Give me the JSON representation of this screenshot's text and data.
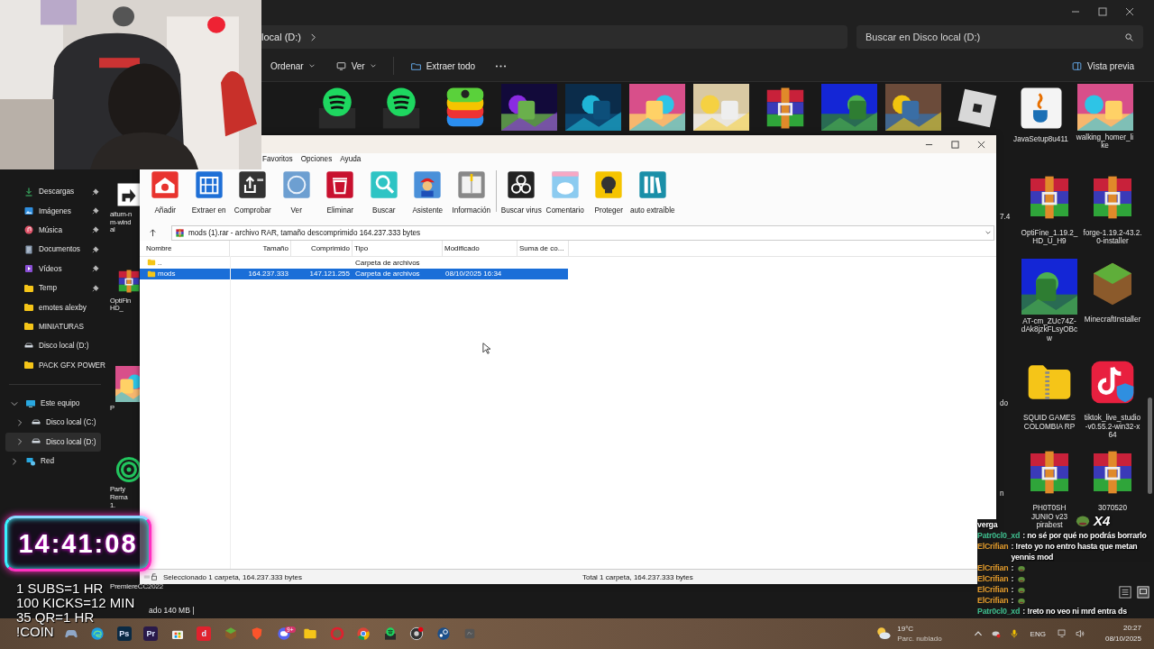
{
  "explorer": {
    "breadcrumb": "local (D:)",
    "search": {
      "placeholder": "Buscar en Disco local (D:)"
    },
    "commands": [
      {
        "label": "Ordenar",
        "kind": "sort",
        "dropdown": true
      },
      {
        "label": "Ver",
        "kind": "view",
        "dropdown": true
      },
      {
        "label": "Extraer todo",
        "kind": "extract",
        "dropdown": false
      }
    ],
    "preview": "Vista previa",
    "quick_access": [
      {
        "label": "Descargas",
        "kind": "download",
        "pinned": true
      },
      {
        "label": "Imágenes",
        "kind": "pictures",
        "pinned": true
      },
      {
        "label": "Música",
        "kind": "music",
        "pinned": true
      },
      {
        "label": "Documentos",
        "kind": "documents",
        "pinned": true
      },
      {
        "label": "Vídeos",
        "kind": "videos",
        "pinned": true
      },
      {
        "label": "Temp",
        "kind": "folder",
        "pinned": true
      },
      {
        "label": "emotes alexby",
        "kind": "folder",
        "pinned": false
      },
      {
        "label": "MINIATURAS",
        "kind": "folder",
        "pinned": false
      },
      {
        "label": "Disco local (D:)",
        "kind": "drive",
        "pinned": false
      },
      {
        "label": "PACK GFX POWER",
        "kind": "folder",
        "pinned": false
      }
    ],
    "tree": [
      {
        "label": "Este equipo",
        "kind": "computer",
        "expanded": true,
        "selected": false,
        "children": [
          {
            "label": "Disco local (C:)",
            "kind": "drive",
            "expanded": false,
            "selected": false
          },
          {
            "label": "Disco local (D:)",
            "kind": "drive",
            "expanded": false,
            "selected": true
          }
        ]
      },
      {
        "label": "Red",
        "kind": "network",
        "expanded": false,
        "selected": false
      }
    ],
    "top_row": [
      {
        "kind": "spotify"
      },
      {
        "kind": "spotify"
      },
      {
        "kind": "bluestacks"
      },
      {
        "kind": "picture"
      },
      {
        "kind": "picture"
      },
      {
        "kind": "picture"
      },
      {
        "kind": "picture"
      },
      {
        "kind": "winrar"
      },
      {
        "kind": "picture"
      },
      {
        "kind": "picture"
      },
      {
        "kind": "roblox"
      },
      {
        "kind": "java",
        "lines": [
          "JavaSetup8u411"
        ]
      },
      {
        "kind": "picture",
        "lines": [
          "walking_homer_li",
          "ke"
        ]
      }
    ],
    "rows": [
      {
        "left": {
          "kind": "shortcut",
          "lines": [
            "aitum-n",
            "m-wind",
            "al"
          ]
        },
        "fragment": "7.4",
        "items": [
          {
            "kind": "winrar",
            "lines": [
              "OptiFine_1.19.2_",
              "HD_U_H9"
            ]
          },
          {
            "kind": "winrar",
            "lines": [
              "forge-1.19.2-43.2.",
              "0-installer"
            ]
          }
        ]
      },
      {
        "left": {
          "kind": "winrar",
          "lines": [
            "OptiFin",
            "HD_"
          ]
        },
        "items": [
          {
            "kind": "picture",
            "lines": [
              "AT-cm_ZUc74Z-",
              "dAk8jzkFLsyOBc",
              "w"
            ]
          },
          {
            "kind": "minecraft",
            "lines": [
              "MinecraftInstaller"
            ]
          }
        ]
      },
      {
        "left": {
          "kind": "picture",
          "lines": [
            "P"
          ]
        },
        "fragment": "do",
        "items": [
          {
            "kind": "zipfolder",
            "lines": [
              "SQUID GAMES",
              "COLOMBIA RP"
            ]
          },
          {
            "kind": "tiktok",
            "lines": [
              "tiktok_live_studio",
              "-v0.55.2-win32-x",
              "64"
            ]
          }
        ]
      },
      {
        "left": {
          "kind": "target",
          "lines": [
            "Party",
            "Rema",
            "1."
          ]
        },
        "fragment": "n",
        "items": [
          {
            "kind": "winrar",
            "lines": [
              "PH0T0SH",
              "JUNIO v23",
              "pirabest"
            ]
          },
          {
            "kind": "winrar",
            "lines": [
              "3070520"
            ]
          }
        ]
      },
      {
        "left": {
          "lines": [
            "PremiereCC2022"
          ]
        }
      }
    ],
    "status_parts": [
      "ado  140 MB  |"
    ]
  },
  "winrar": {
    "menu": [
      "Favoritos",
      "Opciones",
      "Ayuda"
    ],
    "toolbar": [
      {
        "label": "Añadir",
        "kind": "add"
      },
      {
        "label": "Extraer en",
        "kind": "extract"
      },
      {
        "label": "Comprobar",
        "kind": "test"
      },
      {
        "label": "Ver",
        "kind": "view"
      },
      {
        "label": "Eliminar",
        "kind": "delete"
      },
      {
        "label": "Buscar",
        "kind": "find"
      },
      {
        "label": "Asistente",
        "kind": "wizard"
      },
      {
        "label": "Información",
        "kind": "info"
      },
      {
        "label": "Buscar virus",
        "kind": "virus"
      },
      {
        "label": "Comentario",
        "kind": "comment"
      },
      {
        "label": "Proteger",
        "kind": "protect"
      },
      {
        "label": "auto extraíble",
        "kind": "sfx"
      }
    ],
    "path": "mods (1).rar - archivo RAR, tamaño descomprimido 164.237.333 bytes",
    "columns": [
      "Nombre",
      "Tamaño",
      "Comprimido",
      "Tipo",
      "Modificado",
      "Suma de co..."
    ],
    "rows": [
      {
        "name": "..",
        "type": "Carpeta de archivos",
        "selected": false
      },
      {
        "name": "mods",
        "size": "164.237.333",
        "packed": "147.121.255",
        "type": "Carpeta de archivos",
        "modified": "08/10/2025 16:34",
        "selected": true
      }
    ],
    "status_left": "Seleccionado 1 carpeta, 164.237.333 bytes",
    "status_right": "Total 1 carpeta, 164.237.333 bytes"
  },
  "stream": {
    "timer": "14:41:08",
    "rules": [
      "1 SUBS=1 HR",
      "100 KICKS=12 MIN",
      "35 QR=1 HR",
      "!COIN"
    ],
    "emote_count": "X4"
  },
  "chat": [
    {
      "kind": "text",
      "text": "verga"
    },
    {
      "kind": "text",
      "user": "Patr0cl0_xd",
      "color": "#3fbf8f",
      "text": ": no sé por qué no podrás borrarlo"
    },
    {
      "kind": "text",
      "user": "ElCrifian",
      "color": "#e39b2b",
      "text": ": !reto yo no entro hasta que metan yennis mod"
    },
    {
      "kind": "emote",
      "user": "ElCrifian",
      "color": "#e39b2b",
      "text": ":"
    },
    {
      "kind": "emote",
      "user": "ElCrifian",
      "color": "#e39b2b",
      "text": ":"
    },
    {
      "kind": "emote",
      "user": "ElCrifian",
      "color": "#e39b2b",
      "text": ":"
    },
    {
      "kind": "emote",
      "user": "ElCrifian",
      "color": "#e39b2b",
      "text": ":"
    },
    {
      "kind": "text",
      "user": "Patr0cl0_xd",
      "color": "#3fbf8f",
      "text": ": !reto no veo ni mrd entra ds"
    }
  ],
  "taskbar": {
    "apps": [
      {
        "kind": "gamepad"
      },
      {
        "kind": "edge"
      },
      {
        "kind": "tile",
        "label": "Ps",
        "color": "#0a2a44"
      },
      {
        "kind": "tile",
        "label": "Pr",
        "color": "#2a1a4a"
      },
      {
        "kind": "store"
      },
      {
        "kind": "tile",
        "label": "d",
        "color": "#e0222e"
      },
      {
        "kind": "minecraft"
      },
      {
        "kind": "brave"
      },
      {
        "kind": "discord",
        "badge": "9+"
      },
      {
        "kind": "folder"
      },
      {
        "kind": "opera"
      },
      {
        "kind": "chrome"
      },
      {
        "kind": "spotify"
      },
      {
        "kind": "obs"
      },
      {
        "kind": "steam"
      },
      {
        "kind": "app"
      }
    ],
    "weather": {
      "temp": "19°C",
      "desc": "Parc. nublado"
    },
    "language": "ENG",
    "time": "20:27",
    "date": "08/10/2025"
  }
}
